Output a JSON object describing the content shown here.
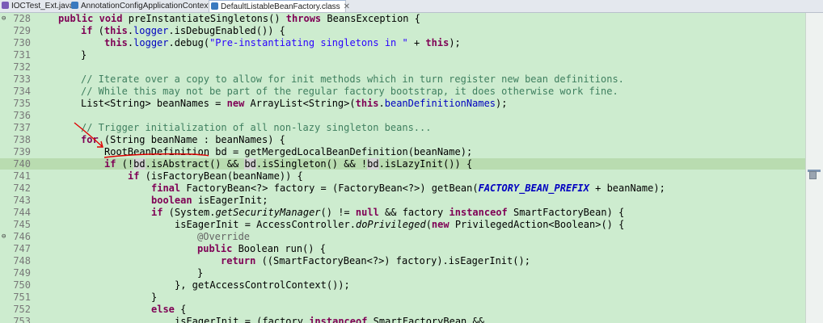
{
  "tabs": [
    {
      "label": "IOCTest_Ext.java"
    },
    {
      "label": "AnnotationConfigApplicationContext.class"
    },
    {
      "label": "DefaultListableBeanFactory.class",
      "close": "✕"
    }
  ],
  "code_lines": [
    {
      "num": "728",
      "fold": "⊖"
    },
    {
      "num": "729"
    },
    {
      "num": "730"
    },
    {
      "num": "731"
    },
    {
      "num": "732"
    },
    {
      "num": "733"
    },
    {
      "num": "734"
    },
    {
      "num": "735"
    },
    {
      "num": "736"
    },
    {
      "num": "737"
    },
    {
      "num": "738"
    },
    {
      "num": "739"
    },
    {
      "num": "740"
    },
    {
      "num": "741"
    },
    {
      "num": "742"
    },
    {
      "num": "743"
    },
    {
      "num": "744"
    },
    {
      "num": "745"
    },
    {
      "num": "746",
      "fold": "⊖"
    },
    {
      "num": "747"
    },
    {
      "num": "748"
    },
    {
      "num": "749"
    },
    {
      "num": "750"
    },
    {
      "num": "751"
    },
    {
      "num": "752"
    },
    {
      "num": "753"
    }
  ],
  "code": {
    "l728": {
      "a": "public",
      "b": "void",
      "c": " preInstantiateSingletons() ",
      "d": "throws",
      "e": " BeansException {"
    },
    "l729": {
      "a": "if",
      "b": " (",
      "c": "this",
      "d": ".",
      "e": "logger",
      "f": ".isDebugEnabled()) {"
    },
    "l730": {
      "a": "this",
      "b": ".",
      "c": "logger",
      "d": ".debug(",
      "e": "\"Pre-instantiating singletons in \"",
      "f": " + ",
      "g": "this",
      "h": ");"
    },
    "l731": "}",
    "l733": "// Iterate over a copy to allow for init methods which in turn register new bean definitions.",
    "l734": "// While this may not be part of the regular factory bootstrap, it does otherwise work fine.",
    "l735": {
      "a": "List<String> ",
      "b": "beanNames",
      "c": " = ",
      "d": "new",
      "e": " ArrayList<String>(",
      "f": "this",
      "g": ".",
      "h": "beanDefinitionNames",
      "i": ");"
    },
    "l737": "// Trigger initialization of all non-lazy singleton beans...",
    "l738": {
      "a": "for",
      "b": " (String ",
      "c": "beanName",
      "d": " : ",
      "e": "beanNames",
      "f": ") {"
    },
    "l739": {
      "a": "RootBeanDefinition ",
      "b": "bd",
      "c": " = getMergedLocalBeanDefinition(",
      "d": "beanName",
      "e": ");"
    },
    "l740": {
      "a": "if",
      "b": " (!",
      "c": "bd",
      "d": ".isAbstract() && ",
      "e": "bd",
      "f": ".isSingleton() && !",
      "g": "bd",
      "h": ".isLazyInit()) {"
    },
    "l741": {
      "a": "if",
      "b": " (isFactoryBean(",
      "c": "beanName",
      "d": ")) {"
    },
    "l742": {
      "a": "final",
      "b": " FactoryBean<?> ",
      "c": "factory",
      "d": " = (FactoryBean<?>) getBean(",
      "e": "FACTORY_BEAN_PREFIX",
      "f": " + ",
      "g": "beanName",
      "h": ");"
    },
    "l743": {
      "a": "boolean",
      "b": " ",
      "c": "isEagerInit",
      "d": ";"
    },
    "l744": {
      "a": "if",
      "b": " (System.",
      "c": "getSecurityManager",
      "d": "() != ",
      "e": "null",
      "f": " && ",
      "g": "factory",
      "h": " ",
      "i": "instanceof",
      "j": " SmartFactoryBean) {"
    },
    "l745": {
      "a": "isEagerInit",
      "b": " = AccessController.",
      "c": "doPrivileged",
      "d": "(",
      "e": "new",
      "f": " PrivilegedAction<Boolean>() {"
    },
    "l746": "@Override",
    "l747": {
      "a": "public",
      "b": " Boolean run() {"
    },
    "l748": {
      "a": "return",
      "b": " ((SmartFactoryBean<?>) ",
      "c": "factory",
      "d": ").isEagerInit();"
    },
    "l749": "}",
    "l750": "}, getAccessControlContext());",
    "l751": "}",
    "l752": {
      "a": "else",
      "b": " {"
    },
    "l753": {
      "a": "isEagerInit",
      "b": " = (",
      "c": "factory",
      "d": " ",
      "e": "instanceof",
      "f": " SmartFactoryBean &&"
    }
  },
  "colors": {
    "editor_bg": "#cdeccf",
    "keyword": "#7f0055",
    "string": "#2a00ff",
    "field": "#0000c0",
    "comment": "#3f7f5f",
    "annotation_ink": "#e00000"
  }
}
